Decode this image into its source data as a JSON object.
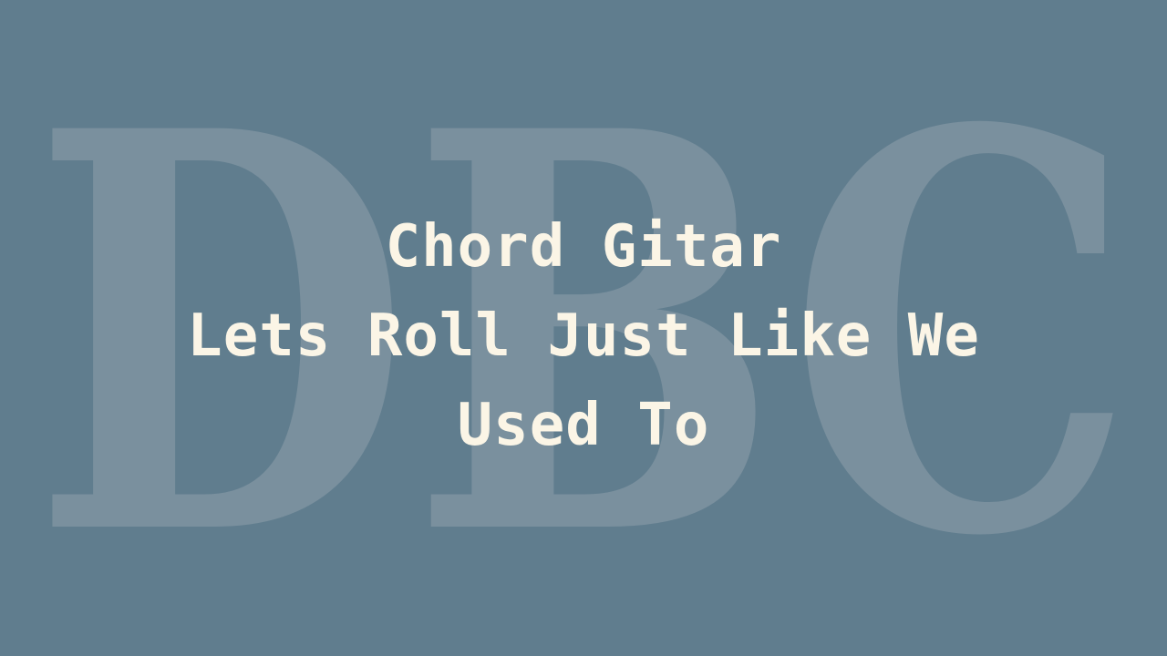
{
  "watermark": {
    "letters": "DBC",
    "color": "#7a909e"
  },
  "title": {
    "line1": "Chord Gitar",
    "line2": "Lets Roll Just Like We",
    "line3": "Used To"
  },
  "colors": {
    "background": "#607d8e",
    "text": "#fbf5e6"
  }
}
